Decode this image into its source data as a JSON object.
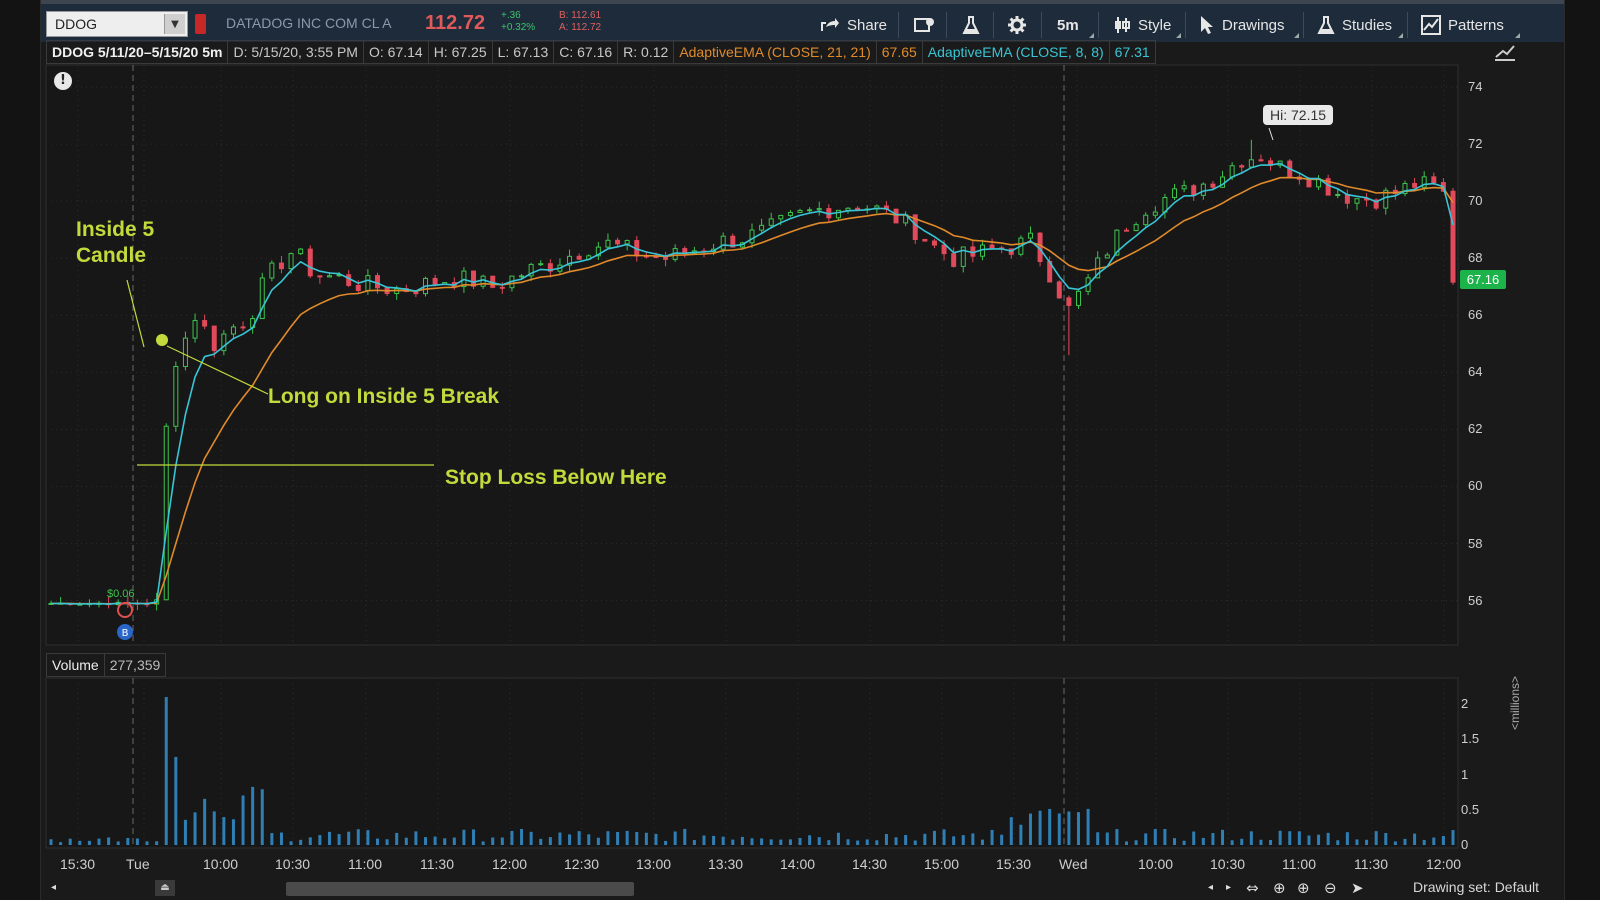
{
  "toolbar": {
    "symbol": "DDOG",
    "company": "DATADOG INC COM CL A",
    "last_price": "112.72",
    "change_abs": "+.36",
    "change_pct": "+0.32%",
    "bid": "B: 112.61",
    "ask": "A: 112.72",
    "share_label": "Share",
    "timeframe_label": "5m",
    "style_label": "Style",
    "drawings_label": "Drawings",
    "studies_label": "Studies",
    "patterns_label": "Patterns"
  },
  "infobar": {
    "title": "DDOG 5/11/20–5/15/20 5m",
    "date": "D: 5/15/20, 3:55 PM",
    "open": "O: 67.14",
    "high": "H: 67.25",
    "low": "L: 67.13",
    "close": "C: 67.16",
    "range": "R: 0.12",
    "study1_label": "AdaptiveEMA (CLOSE, 21, 21)",
    "study1_value": "67.65",
    "study2_label": "AdaptiveEMA (CLOSE, 8, 8)",
    "study2_value": "67.31"
  },
  "annotations": {
    "inside5": "Inside 5\nCandle",
    "long": "Long on Inside 5 Break",
    "stop": "Stop Loss Below Here",
    "hi": "Hi: 72.15",
    "last_tag": "67.16",
    "entry_badge": "$0.06"
  },
  "volume": {
    "label": "Volume",
    "value": "277,359",
    "units": "<millions>"
  },
  "bottom": {
    "drawing_set": "Drawing set: Default"
  },
  "colors": {
    "up": "#3ec34e",
    "down": "#e04a5a",
    "ema21": "#e08a2a",
    "ema8": "#38c5d5",
    "annotation": "#c3da3c",
    "volume": "#2f7fb5"
  },
  "chart_data": {
    "type": "candlestick",
    "price_axis": {
      "ticks": [
        "74",
        "72",
        "70",
        "68",
        "66",
        "64",
        "62",
        "60",
        "58",
        "56"
      ],
      "range": [
        55,
        74.5
      ]
    },
    "volume_axis": {
      "ticks": [
        "2",
        "1.5",
        "1",
        "0.5",
        "0"
      ],
      "range": [
        0,
        2.2
      ]
    },
    "x_ticks": [
      "15:30",
      "Tue",
      "10:00",
      "10:30",
      "11:00",
      "11:30",
      "12:00",
      "12:30",
      "13:00",
      "13:30",
      "14:00",
      "14:30",
      "15:00",
      "15:30",
      "Wed",
      "10:00",
      "10:30",
      "11:00",
      "11:30",
      "12:00"
    ],
    "price_path": [
      [
        0,
        55.9
      ],
      [
        5,
        55.9
      ],
      [
        10,
        55.9
      ],
      [
        11,
        56.0
      ],
      [
        12,
        62.0
      ],
      [
        13,
        64.5
      ],
      [
        14,
        65.2
      ],
      [
        15,
        66.0
      ],
      [
        16,
        65.5
      ],
      [
        17,
        65.0
      ],
      [
        18,
        65.3
      ],
      [
        19,
        65.6
      ],
      [
        20,
        65.8
      ],
      [
        21,
        66.2
      ],
      [
        22,
        67.0
      ],
      [
        23,
        67.5
      ],
      [
        24,
        67.9
      ],
      [
        25,
        68.2
      ],
      [
        26,
        68.0
      ],
      [
        27,
        67.6
      ],
      [
        28,
        67.4
      ],
      [
        30,
        67.3
      ],
      [
        32,
        67.1
      ],
      [
        34,
        67.0
      ],
      [
        36,
        66.9
      ],
      [
        38,
        67.0
      ],
      [
        40,
        67.2
      ],
      [
        42,
        67.3
      ],
      [
        44,
        67.2
      ],
      [
        46,
        67.0
      ],
      [
        48,
        67.3
      ],
      [
        50,
        67.6
      ],
      [
        52,
        67.8
      ],
      [
        54,
        68.1
      ],
      [
        56,
        68.4
      ],
      [
        58,
        68.5
      ],
      [
        60,
        68.3
      ],
      [
        62,
        68.1
      ],
      [
        64,
        68.0
      ],
      [
        66,
        68.2
      ],
      [
        68,
        68.4
      ],
      [
        70,
        68.6
      ],
      [
        72,
        68.7
      ],
      [
        74,
        68.9
      ],
      [
        76,
        69.2
      ],
      [
        78,
        69.5
      ],
      [
        80,
        69.7
      ],
      [
        82,
        69.8
      ],
      [
        84,
        69.9
      ],
      [
        86,
        69.7
      ],
      [
        88,
        69.4
      ],
      [
        90,
        69.0
      ],
      [
        92,
        68.4
      ],
      [
        94,
        68.0
      ],
      [
        96,
        68.1
      ],
      [
        98,
        68.3
      ],
      [
        100,
        68.4
      ],
      [
        102,
        68.6
      ],
      [
        104,
        67.5
      ],
      [
        106,
        66.2
      ],
      [
        108,
        67.2
      ],
      [
        110,
        68.3
      ],
      [
        112,
        69.2
      ],
      [
        114,
        69.8
      ],
      [
        116,
        70.1
      ],
      [
        118,
        70.3
      ],
      [
        120,
        70.6
      ],
      [
        122,
        71.0
      ],
      [
        124,
        71.5
      ],
      [
        126,
        71.6
      ],
      [
        128,
        71.2
      ],
      [
        130,
        71.0
      ],
      [
        132,
        70.7
      ],
      [
        134,
        70.3
      ],
      [
        136,
        70.1
      ],
      [
        138,
        70.1
      ],
      [
        140,
        70.3
      ],
      [
        142,
        70.6
      ],
      [
        144,
        70.5
      ],
      [
        146,
        70.0
      ]
    ],
    "high": 72.15,
    "last": 67.16,
    "stop_loss_level": 61.0
  }
}
